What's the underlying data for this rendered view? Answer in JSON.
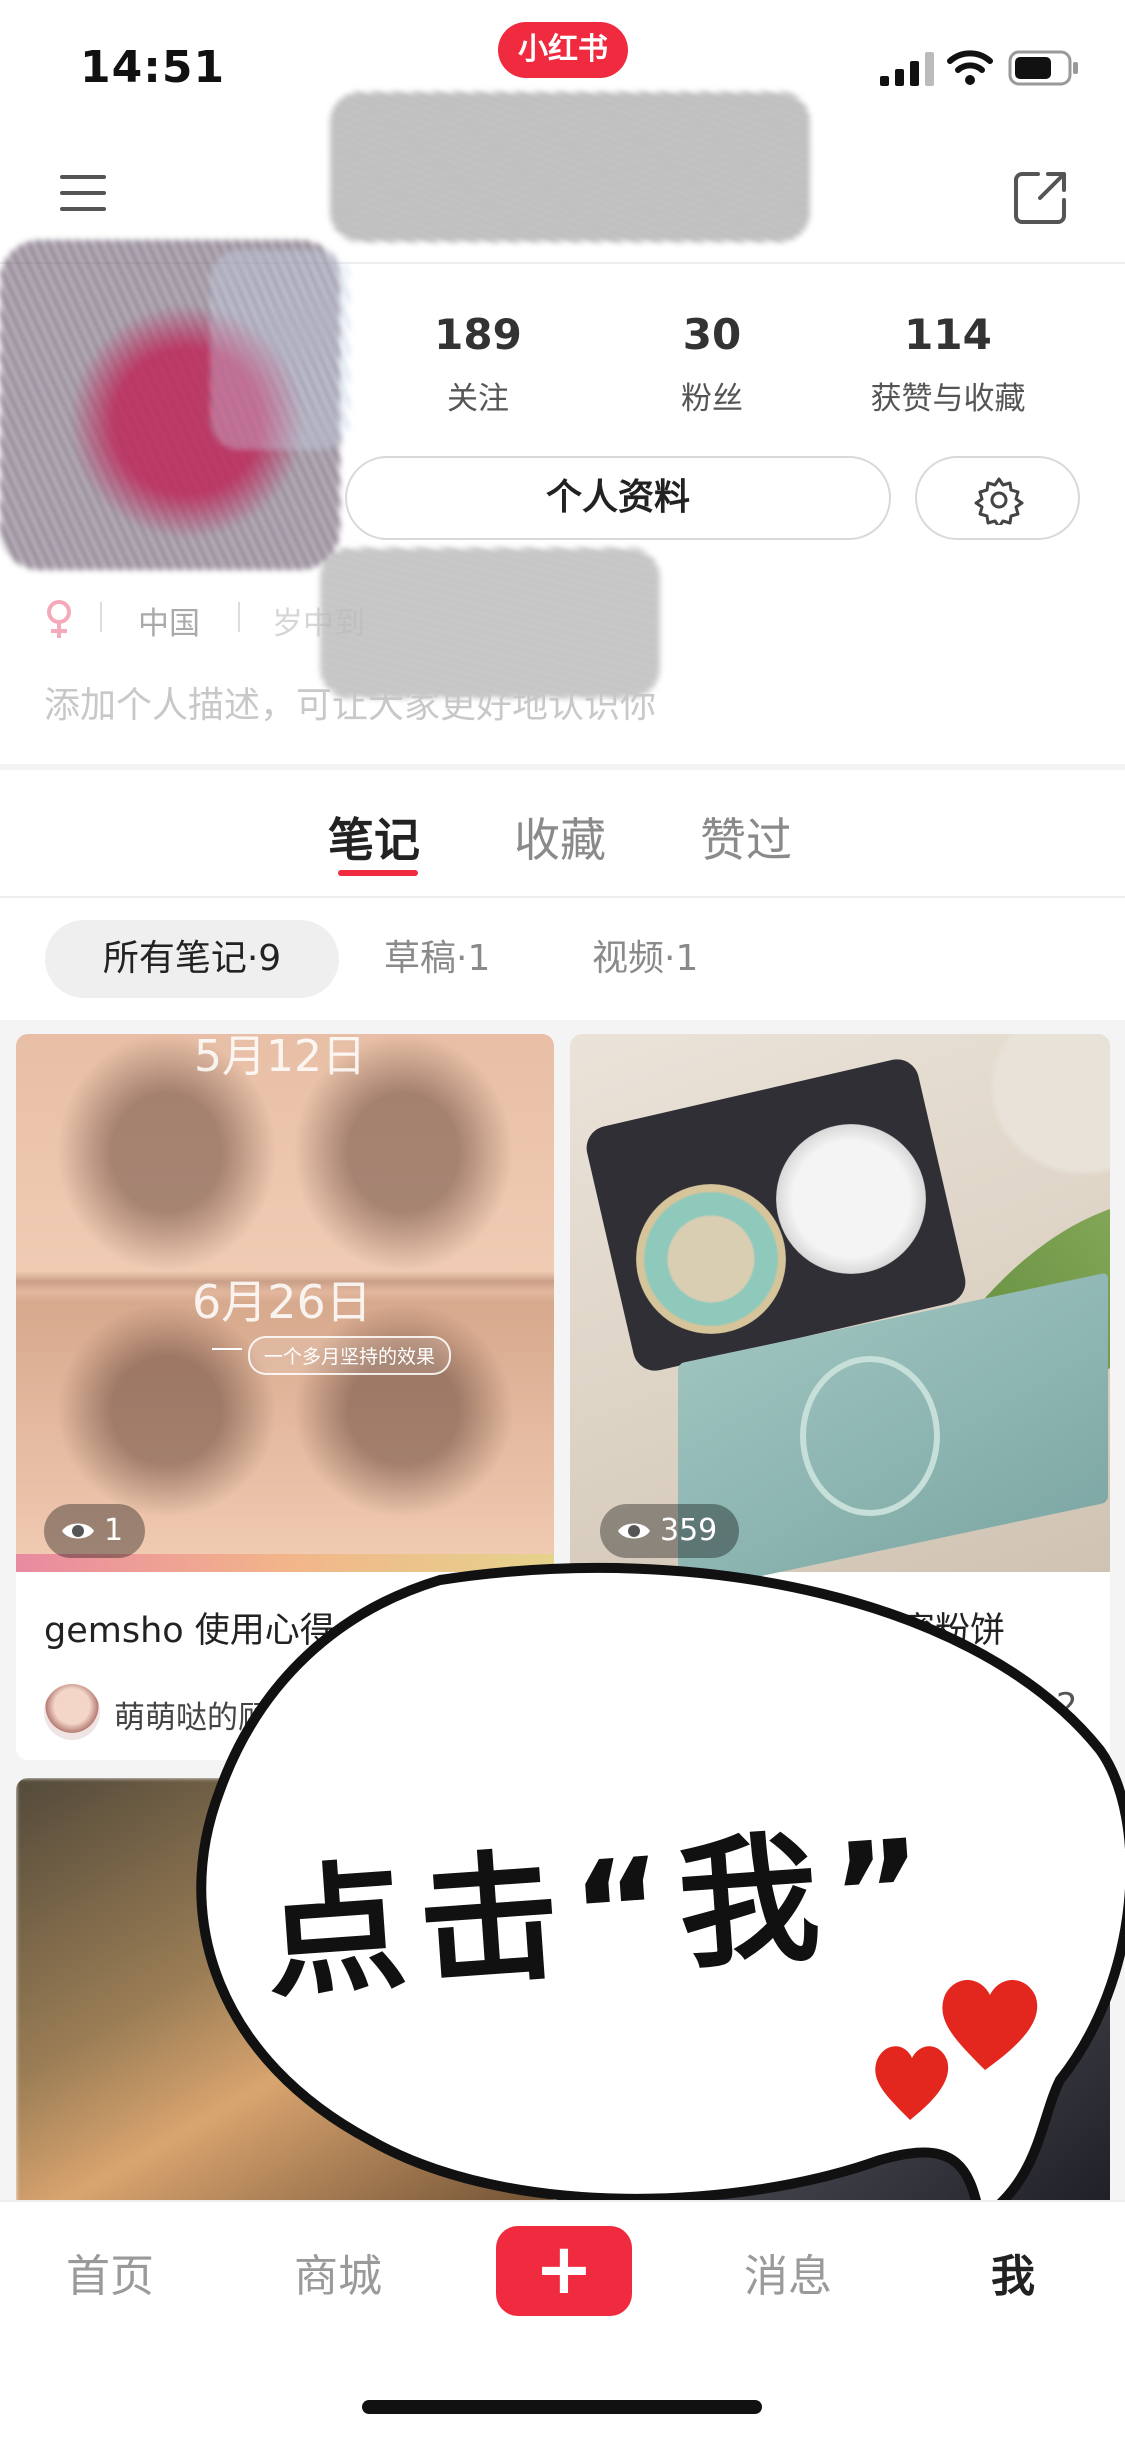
{
  "status_bar": {
    "time": "14:51",
    "app_badge": "小红书"
  },
  "stats": {
    "following": {
      "value": "189",
      "label": "关注"
    },
    "followers": {
      "value": "30",
      "label": "粉丝"
    },
    "likes_and_saves": {
      "value": "114",
      "label": "获赞与收藏"
    }
  },
  "buttons": {
    "profile": "个人资料"
  },
  "meta": {
    "location": "中国",
    "age": "岁中到"
  },
  "bio_placeholder": "添加个人描述，可让大家更好地认识你",
  "tabs": [
    {
      "label": "笔记",
      "active": true
    },
    {
      "label": "收藏",
      "active": false
    },
    {
      "label": "赞过",
      "active": false
    }
  ],
  "filters": [
    {
      "label": "所有笔记·9",
      "active": true
    },
    {
      "label": "草稿·1",
      "active": false
    },
    {
      "label": "视频·1",
      "active": false
    }
  ],
  "notes": [
    {
      "title": "gemsho 使用心得",
      "author": "萌萌哒的顾",
      "views": "1",
      "overlay_text": {
        "top_date": "5月12日",
        "mid_date": "6月26日",
        "caption": "一个多月坚持的效果"
      }
    },
    {
      "title": "天使蜜粉饼",
      "views": "359",
      "likes": "2"
    }
  ],
  "nav": {
    "home": "首页",
    "mall": "商城",
    "create": "+",
    "messages": "消息",
    "me": "我"
  },
  "overlay_callout": "点击“我”",
  "icons": [
    "menu-icon",
    "share-icon",
    "settings-icon",
    "eye-icon",
    "heart-icon",
    "signal-icon",
    "wifi-icon",
    "battery-icon"
  ],
  "colors": {
    "accent": "#f12b3f",
    "text": "#222222",
    "muted": "#8a8a8a"
  }
}
